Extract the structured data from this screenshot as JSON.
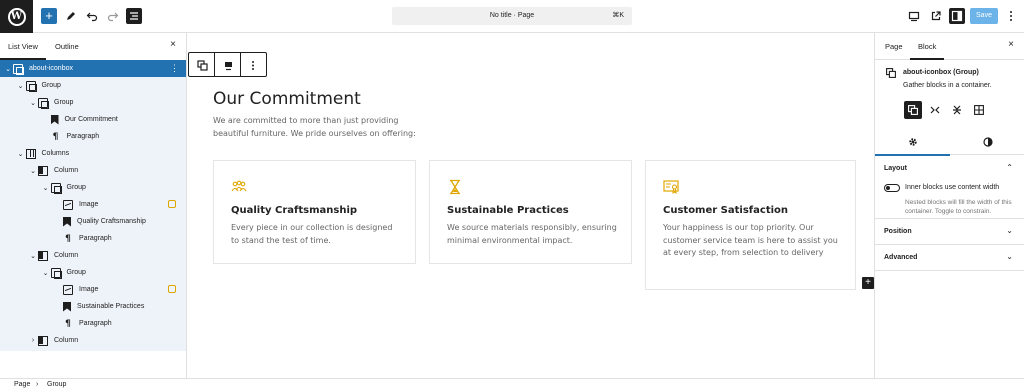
{
  "topbar": {
    "add_label": "+",
    "document_title": "No title · Page",
    "shortcut": "⌘K",
    "save_label": "Save"
  },
  "list_panel": {
    "tabs": [
      "List View",
      "Outline"
    ],
    "close": "×",
    "rows": [
      {
        "label": "about-iconbox",
        "icon": "group-icon",
        "chevron": "⌄",
        "selected": true,
        "warning": false
      },
      {
        "label": "Group",
        "icon": "group-icon",
        "chevron": "⌄",
        "selected": false,
        "warning": false
      },
      {
        "label": "Group",
        "icon": "group-icon",
        "chevron": "⌄",
        "selected": false,
        "warning": false
      },
      {
        "label": "Our Commitment",
        "icon": "heading-icon",
        "chevron": "",
        "selected": false,
        "warning": false
      },
      {
        "label": "Paragraph",
        "icon": "paragraph-icon",
        "chevron": "",
        "selected": false,
        "warning": false
      },
      {
        "label": "Columns",
        "icon": "columns-icon",
        "chevron": "⌄",
        "selected": false,
        "warning": false
      },
      {
        "label": "Column",
        "icon": "column-icon",
        "chevron": "⌄",
        "selected": false,
        "warning": false
      },
      {
        "label": "Group",
        "icon": "group-icon",
        "chevron": "⌄",
        "selected": false,
        "warning": false
      },
      {
        "label": "Image",
        "icon": "image-icon",
        "chevron": "",
        "selected": false,
        "warning": true
      },
      {
        "label": "Quality Craftsmanship",
        "icon": "heading-icon",
        "chevron": "",
        "selected": false,
        "warning": false
      },
      {
        "label": "Paragraph",
        "icon": "paragraph-icon",
        "chevron": "",
        "selected": false,
        "warning": false
      },
      {
        "label": "Column",
        "icon": "column-icon",
        "chevron": "⌄",
        "selected": false,
        "warning": false
      },
      {
        "label": "Group",
        "icon": "group-icon",
        "chevron": "⌄",
        "selected": false,
        "warning": false
      },
      {
        "label": "Image",
        "icon": "image-icon",
        "chevron": "",
        "selected": false,
        "warning": true
      },
      {
        "label": "Sustainable Practices",
        "icon": "heading-icon",
        "chevron": "",
        "selected": false,
        "warning": false
      },
      {
        "label": "Paragraph",
        "icon": "paragraph-icon",
        "chevron": "",
        "selected": false,
        "warning": false
      },
      {
        "label": "Column",
        "icon": "column-icon",
        "chevron": "›",
        "selected": false,
        "warning": false
      }
    ]
  },
  "canvas": {
    "heading": "Our Commitment",
    "intro": "We are committed to more than just providing beautiful furniture. We pride ourselves on offering:",
    "cards": [
      {
        "title": "Quality Craftsmanship",
        "text": "Every piece in our collection is designed to stand the test of time.",
        "icon": "people-icon"
      },
      {
        "title": "Sustainable Practices",
        "text": "We source materials responsibly, ensuring minimal environmental impact.",
        "icon": "hourglass-icon"
      },
      {
        "title": "Customer Satisfaction",
        "text": "Your happiness is our top priority. Our customer service team is here to assist you at every step, from selection to delivery",
        "icon": "certificate-icon"
      }
    ],
    "accent_color": "#e0a600"
  },
  "settings": {
    "tabs": [
      "Page",
      "Block"
    ],
    "close": "×",
    "block_name": "about-iconbox (Group)",
    "block_desc": "Gather blocks in a container.",
    "layout": {
      "title": "Layout",
      "toggle_label": "Inner blocks use content width",
      "toggle_help": "Nested blocks will fill the width of this container. Toggle to constrain."
    },
    "position_title": "Position",
    "advanced_title": "Advanced"
  },
  "breadcrumb": [
    "Page",
    "Group"
  ],
  "breadcrumb_sep": "›"
}
